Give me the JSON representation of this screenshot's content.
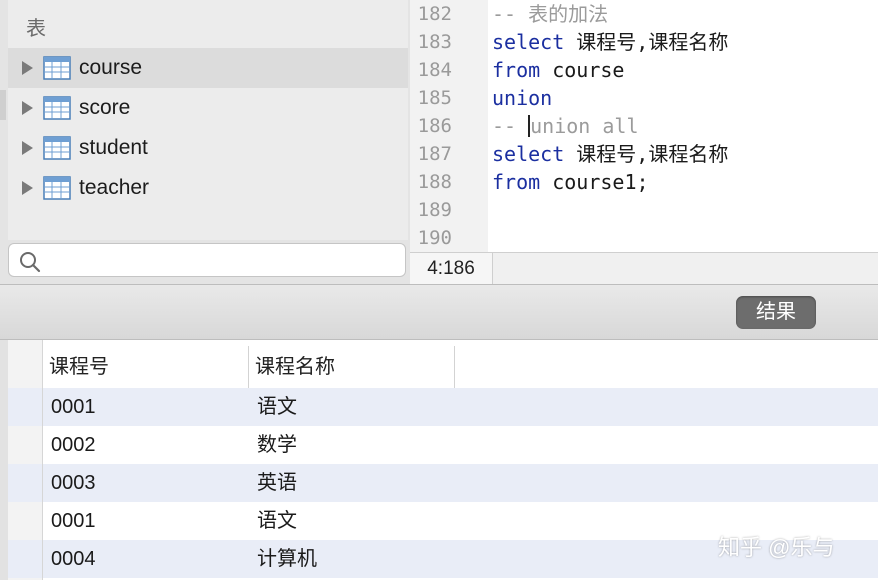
{
  "sidebar": {
    "header": "表",
    "tables": [
      {
        "name": "course",
        "selected": true
      },
      {
        "name": "score",
        "selected": false
      },
      {
        "name": "student",
        "selected": false
      },
      {
        "name": "teacher",
        "selected": false
      }
    ],
    "search_placeholder": ""
  },
  "editor": {
    "lines": [
      {
        "no": "182",
        "tokens": [
          {
            "t": "-- 表的加法",
            "k": "cm"
          }
        ]
      },
      {
        "no": "183",
        "tokens": [
          {
            "t": "select",
            "k": "kw"
          },
          {
            "t": " 课程号,课程名称",
            "k": "pl"
          }
        ]
      },
      {
        "no": "184",
        "tokens": [
          {
            "t": "from",
            "k": "kw"
          },
          {
            "t": " course",
            "k": "pl"
          }
        ]
      },
      {
        "no": "185",
        "tokens": [
          {
            "t": "union",
            "k": "kw"
          }
        ]
      },
      {
        "no": "186",
        "tokens": [
          {
            "t": "-- ",
            "k": "cm"
          },
          {
            "t": "",
            "k": "cursor"
          },
          {
            "t": "union all",
            "k": "cm"
          }
        ]
      },
      {
        "no": "187",
        "tokens": [
          {
            "t": "select",
            "k": "kw"
          },
          {
            "t": " 课程号,课程名称",
            "k": "pl"
          }
        ]
      },
      {
        "no": "188",
        "tokens": [
          {
            "t": "from",
            "k": "kw"
          },
          {
            "t": " course1;",
            "k": "pl"
          }
        ]
      },
      {
        "no": "189",
        "tokens": []
      },
      {
        "no": "190",
        "tokens": []
      }
    ],
    "cursor_position": "4:186"
  },
  "results": {
    "button_label": "结果",
    "columns": [
      "课程号",
      "课程名称"
    ],
    "rows": [
      [
        "0001",
        "语文"
      ],
      [
        "0002",
        "数学"
      ],
      [
        "0003",
        "英语"
      ],
      [
        "0001",
        "语文"
      ],
      [
        "0004",
        "计算机"
      ]
    ]
  },
  "watermark": "知乎 @乐与",
  "colors": {
    "keyword": "#1b2fa0",
    "comment": "#9b9b9b",
    "row_alt": "#e9edf7",
    "button_bg": "#6d6d6d"
  }
}
